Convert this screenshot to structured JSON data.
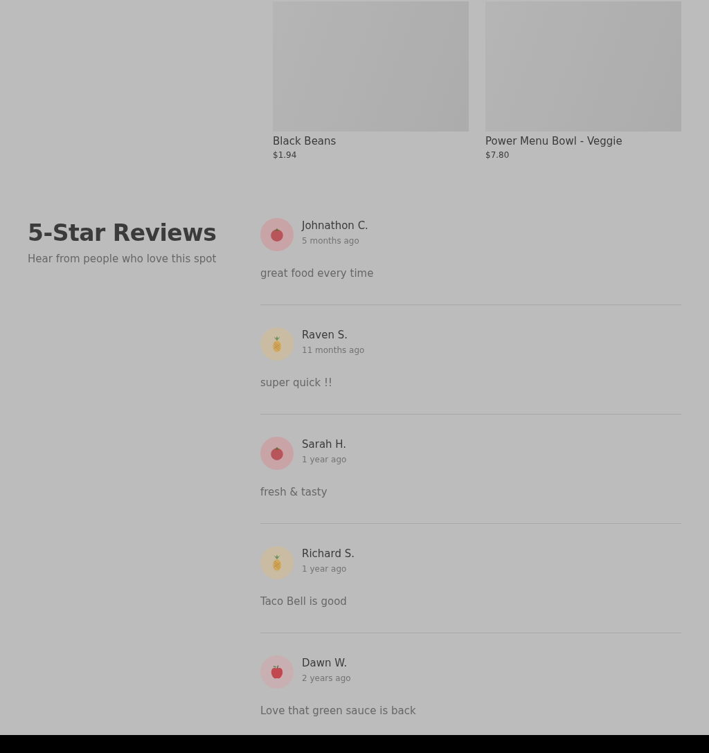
{
  "menu_items": [
    {
      "name": "Black Beans",
      "price": "$1.94"
    },
    {
      "name": "Power Menu Bowl - Veggie",
      "price": "$7.80"
    }
  ],
  "reviews_section": {
    "title": "5-Star Reviews",
    "subtitle": "Hear from people who love this spot"
  },
  "reviews": [
    {
      "author": "Johnathon C.",
      "time": "5 months ago",
      "text": "great food every time",
      "avatar": {
        "kind": "tomato"
      }
    },
    {
      "author": "Raven S.",
      "time": "11 months ago",
      "text": "super quick !!",
      "avatar": {
        "kind": "pineapple"
      }
    },
    {
      "author": "Sarah H.",
      "time": "1 year ago",
      "text": "fresh & tasty",
      "avatar": {
        "kind": "tomato"
      }
    },
    {
      "author": "Richard S.",
      "time": "1 year ago",
      "text": "Taco Bell is good",
      "avatar": {
        "kind": "pineapple"
      }
    },
    {
      "author": "Dawn W.",
      "time": "2 years ago",
      "text": "Love that green sauce is back",
      "avatar": {
        "kind": "apple"
      }
    }
  ]
}
